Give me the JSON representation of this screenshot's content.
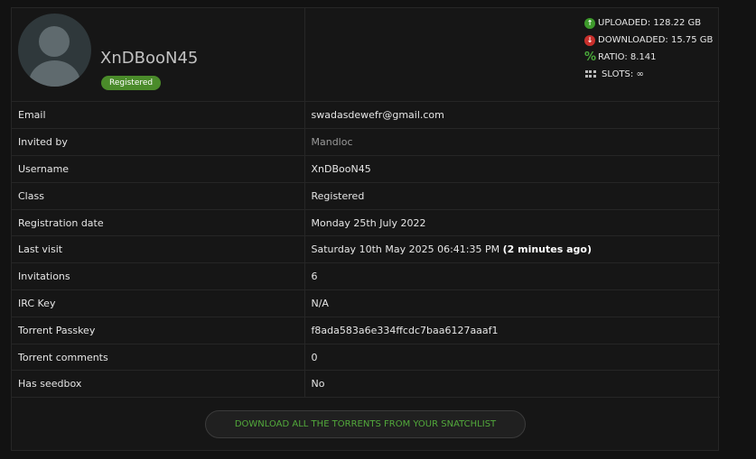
{
  "profile": {
    "username": "XnDBooN45",
    "badge": "Registered"
  },
  "stats": {
    "uploaded": "UPLOADED: 128.22 GB",
    "downloaded": "DOWNLOADED:  15.75 GB",
    "ratio": "RATIO: 8.141",
    "slots": "SLOTS: ∞"
  },
  "icons": {
    "uploaded": "upload-arrow-icon",
    "downloaded": "download-arrow-icon",
    "ratio": "percent-icon",
    "slots": "grid-slots-icon"
  },
  "rows": [
    {
      "label": "Email",
      "value": "swadasdewefr@gmail.com"
    },
    {
      "label": "Invited by",
      "value": "Mandloc"
    },
    {
      "label": "Username",
      "value": "XnDBooN45"
    },
    {
      "label": "Class",
      "value": "Registered"
    },
    {
      "label": "Registration date",
      "value": "Monday 25th July 2022"
    },
    {
      "label": "Last visit",
      "value": "Saturday 10th May 2025 06:41:35 PM",
      "extra": "(2 minutes ago)"
    },
    {
      "label": "Invitations",
      "value": "6"
    },
    {
      "label": "IRC Key",
      "value": "N/A"
    },
    {
      "label": "Torrent Passkey",
      "value": "f8ada583a6e334ffcdc7baa6127aaaf1"
    },
    {
      "label": "Torrent comments",
      "value": "0"
    },
    {
      "label": "Has seedbox",
      "value": "No"
    }
  ],
  "download_button": "DOWNLOAD ALL THE TORRENTS FROM YOUR SNATCHLIST",
  "colors": {
    "accent_green": "#52a93b",
    "badge_green": "#4a8b2a",
    "down_red": "#c9302c"
  }
}
